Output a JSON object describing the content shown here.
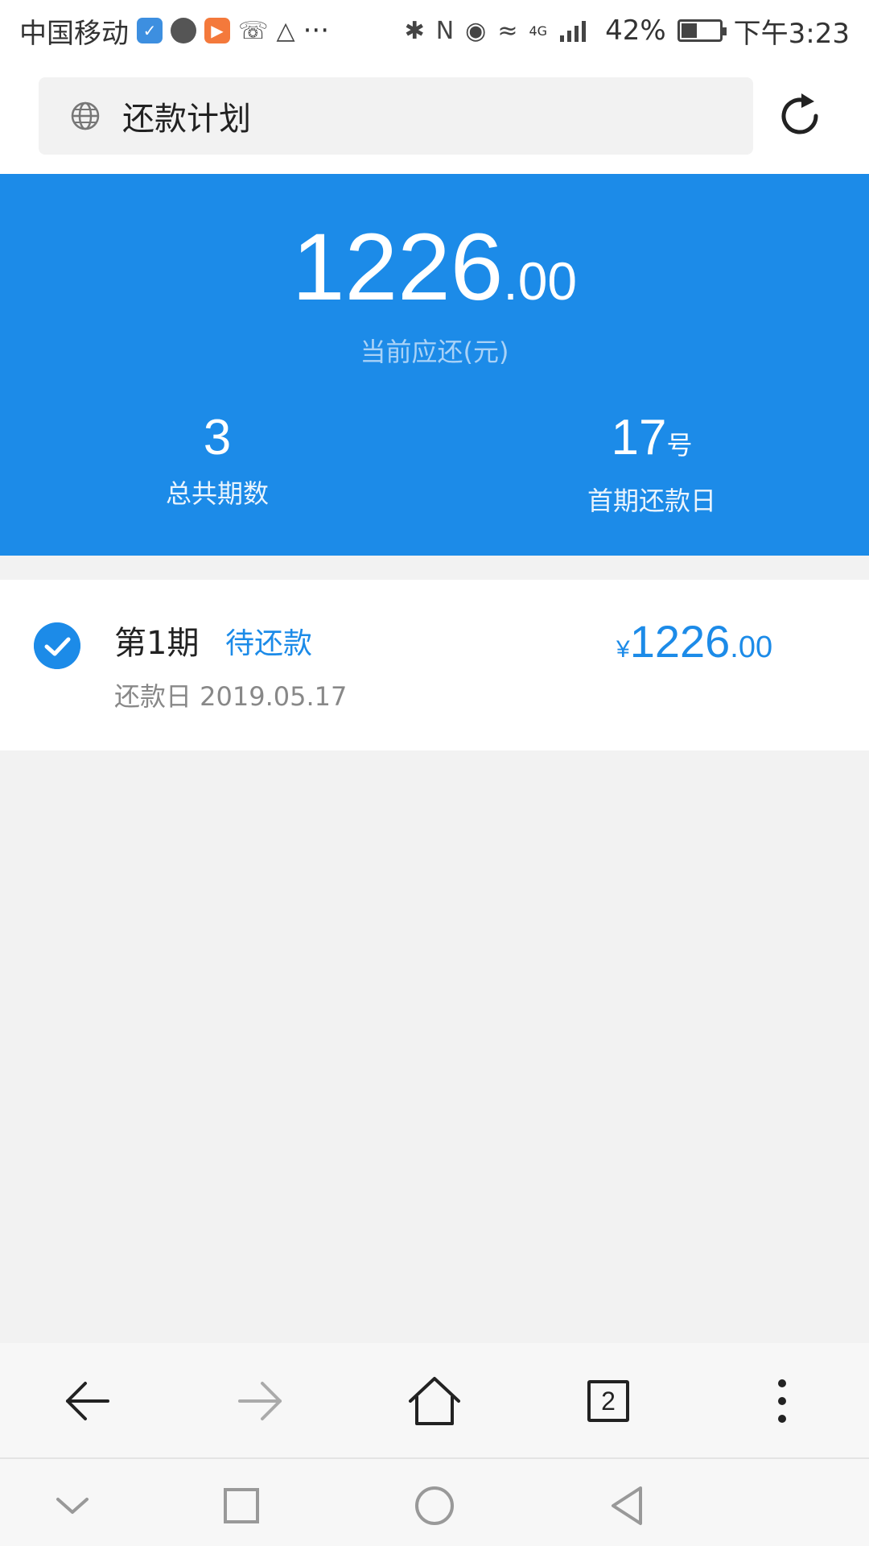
{
  "status_bar": {
    "carrier": "中国移动",
    "more": "···",
    "network": "4G",
    "battery_percent": "42%",
    "battery_level": 0.42,
    "time": "下午3:23"
  },
  "address_bar": {
    "title": "还款计划"
  },
  "summary": {
    "amount_int": "1226",
    "amount_dec": ".00",
    "amount_label": "当前应还(元)",
    "total_periods_value": "3",
    "total_periods_label": "总共期数",
    "first_due_value": "17",
    "first_due_unit": "号",
    "first_due_label": "首期还款日"
  },
  "installments": [
    {
      "period": "第1期",
      "status": "待还款",
      "due_date": "还款日 2019.05.17",
      "currency": "¥",
      "amount_int": "1226",
      "amount_dec": ".00"
    }
  ],
  "browser_toolbar": {
    "tab_count": "2"
  },
  "colors": {
    "accent": "#1c8be8",
    "background": "#f2f2f2"
  },
  "icons": {
    "address": "globe-icon",
    "refresh": "refresh-icon",
    "check": "check-circle-icon",
    "back": "back-arrow-icon",
    "forward": "forward-arrow-icon",
    "home": "home-icon",
    "tabs": "tabs-icon",
    "menu": "more-vertical-icon",
    "sys_collapse": "chevron-down-icon",
    "sys_recent": "square-icon",
    "sys_home": "circle-icon",
    "sys_back": "triangle-back-icon"
  }
}
